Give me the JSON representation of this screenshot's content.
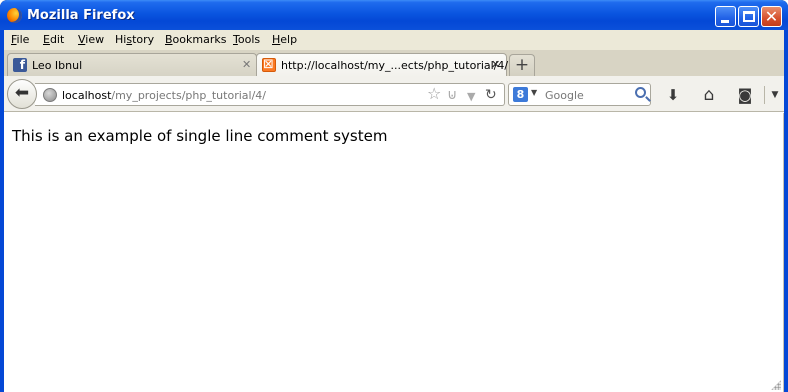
{
  "window": {
    "title": "Mozilla Firefox"
  },
  "menu": [
    {
      "accel": "F",
      "rest": "ile"
    },
    {
      "accel": "E",
      "rest": "dit"
    },
    {
      "accel": "V",
      "rest": "iew"
    },
    {
      "prefix": "Hi",
      "accel": "s",
      "rest": "tory"
    },
    {
      "accel": "B",
      "rest": "ookmarks"
    },
    {
      "accel": "T",
      "rest": "ools"
    },
    {
      "accel": "H",
      "rest": "elp"
    }
  ],
  "tabs": [
    {
      "label": "Leo Ibnul",
      "icon": "facebook-icon",
      "active": false
    },
    {
      "label": "http://localhost/my_...ects/php_tutorial/4/",
      "icon": "xampp-icon",
      "active": true
    }
  ],
  "new_tab_label": "+",
  "address": {
    "host": "localhost",
    "path": "/my_projects/php_tutorial/4/"
  },
  "search": {
    "engine_letter": "8",
    "placeholder": "Google"
  },
  "page": {
    "text": "This is an example of single line comment system"
  },
  "colors": {
    "titlebar": "#0a55e0",
    "chrome": "#ece9d8"
  }
}
